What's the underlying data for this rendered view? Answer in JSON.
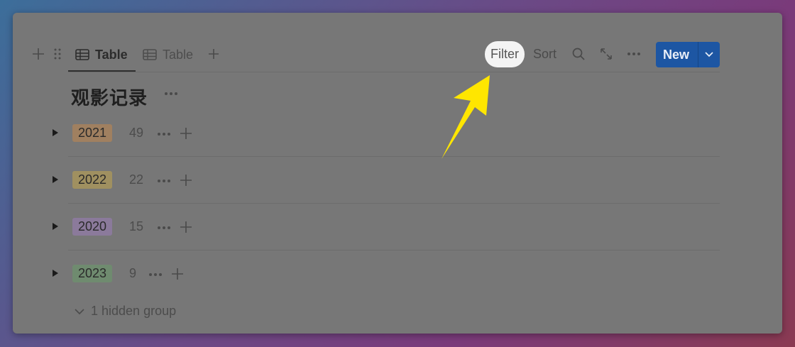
{
  "toolbar": {
    "tabs": [
      {
        "label": "Table",
        "active": true
      },
      {
        "label": "Table",
        "active": false
      }
    ],
    "filter_label": "Filter",
    "sort_label": "Sort",
    "new_label": "New",
    "icons": [
      "plus-icon",
      "drag-handle-icon",
      "table-icon",
      "search-icon",
      "expand-icon",
      "more-icon",
      "chevron-down-icon"
    ]
  },
  "database": {
    "title": "观影记录"
  },
  "groups": [
    {
      "label": "2021",
      "count": "49",
      "color": "#a08060"
    },
    {
      "label": "2022",
      "count": "22",
      "color": "#a09060"
    },
    {
      "label": "2020",
      "count": "15",
      "color": "#8b7a9b"
    },
    {
      "label": "2023",
      "count": "9",
      "color": "#6f8b6f"
    }
  ],
  "hidden_group_label": "1 hidden group",
  "annotation_color": "#ffe600",
  "accent_color": "#1d56a3"
}
